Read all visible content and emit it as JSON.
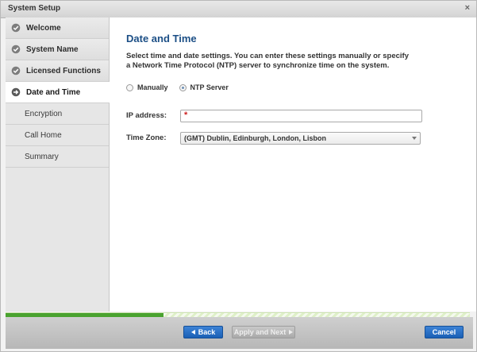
{
  "window": {
    "title": "System Setup",
    "close_glyph": "×"
  },
  "sidebar": {
    "items": [
      {
        "label": "Welcome",
        "state": "done",
        "icon": "check-circle-icon"
      },
      {
        "label": "System Name",
        "state": "done",
        "icon": "check-circle-icon"
      },
      {
        "label": "Licensed Functions",
        "state": "done",
        "icon": "check-circle-icon"
      },
      {
        "label": "Date and Time",
        "state": "current",
        "icon": "arrow-right-circle-icon"
      },
      {
        "label": "Encryption",
        "state": "pending"
      },
      {
        "label": "Call Home",
        "state": "pending"
      },
      {
        "label": "Summary",
        "state": "pending"
      }
    ]
  },
  "main": {
    "heading": "Date and Time",
    "description": "Select time and date settings. You can enter these settings manually or specify a Network Time Protocol (NTP) server to synchronize time on the system.",
    "mode_options": [
      {
        "label": "Manually",
        "selected": false
      },
      {
        "label": "NTP Server",
        "selected": true
      }
    ],
    "ip_address": {
      "label": "IP address:",
      "value": "",
      "required_marker": "*"
    },
    "time_zone": {
      "label": "Time Zone:",
      "selected": "(GMT) Dublin, Edinburgh, London, Lisbon"
    }
  },
  "progress": {
    "fraction": 0.34
  },
  "footer": {
    "back_label": "Back",
    "next_label": "Apply and Next",
    "cancel_label": "Cancel"
  },
  "colors": {
    "accent": "#1c4f86",
    "primary_button": "#2a6fc6",
    "progress": "#4aa32f",
    "required": "#cc2222"
  }
}
